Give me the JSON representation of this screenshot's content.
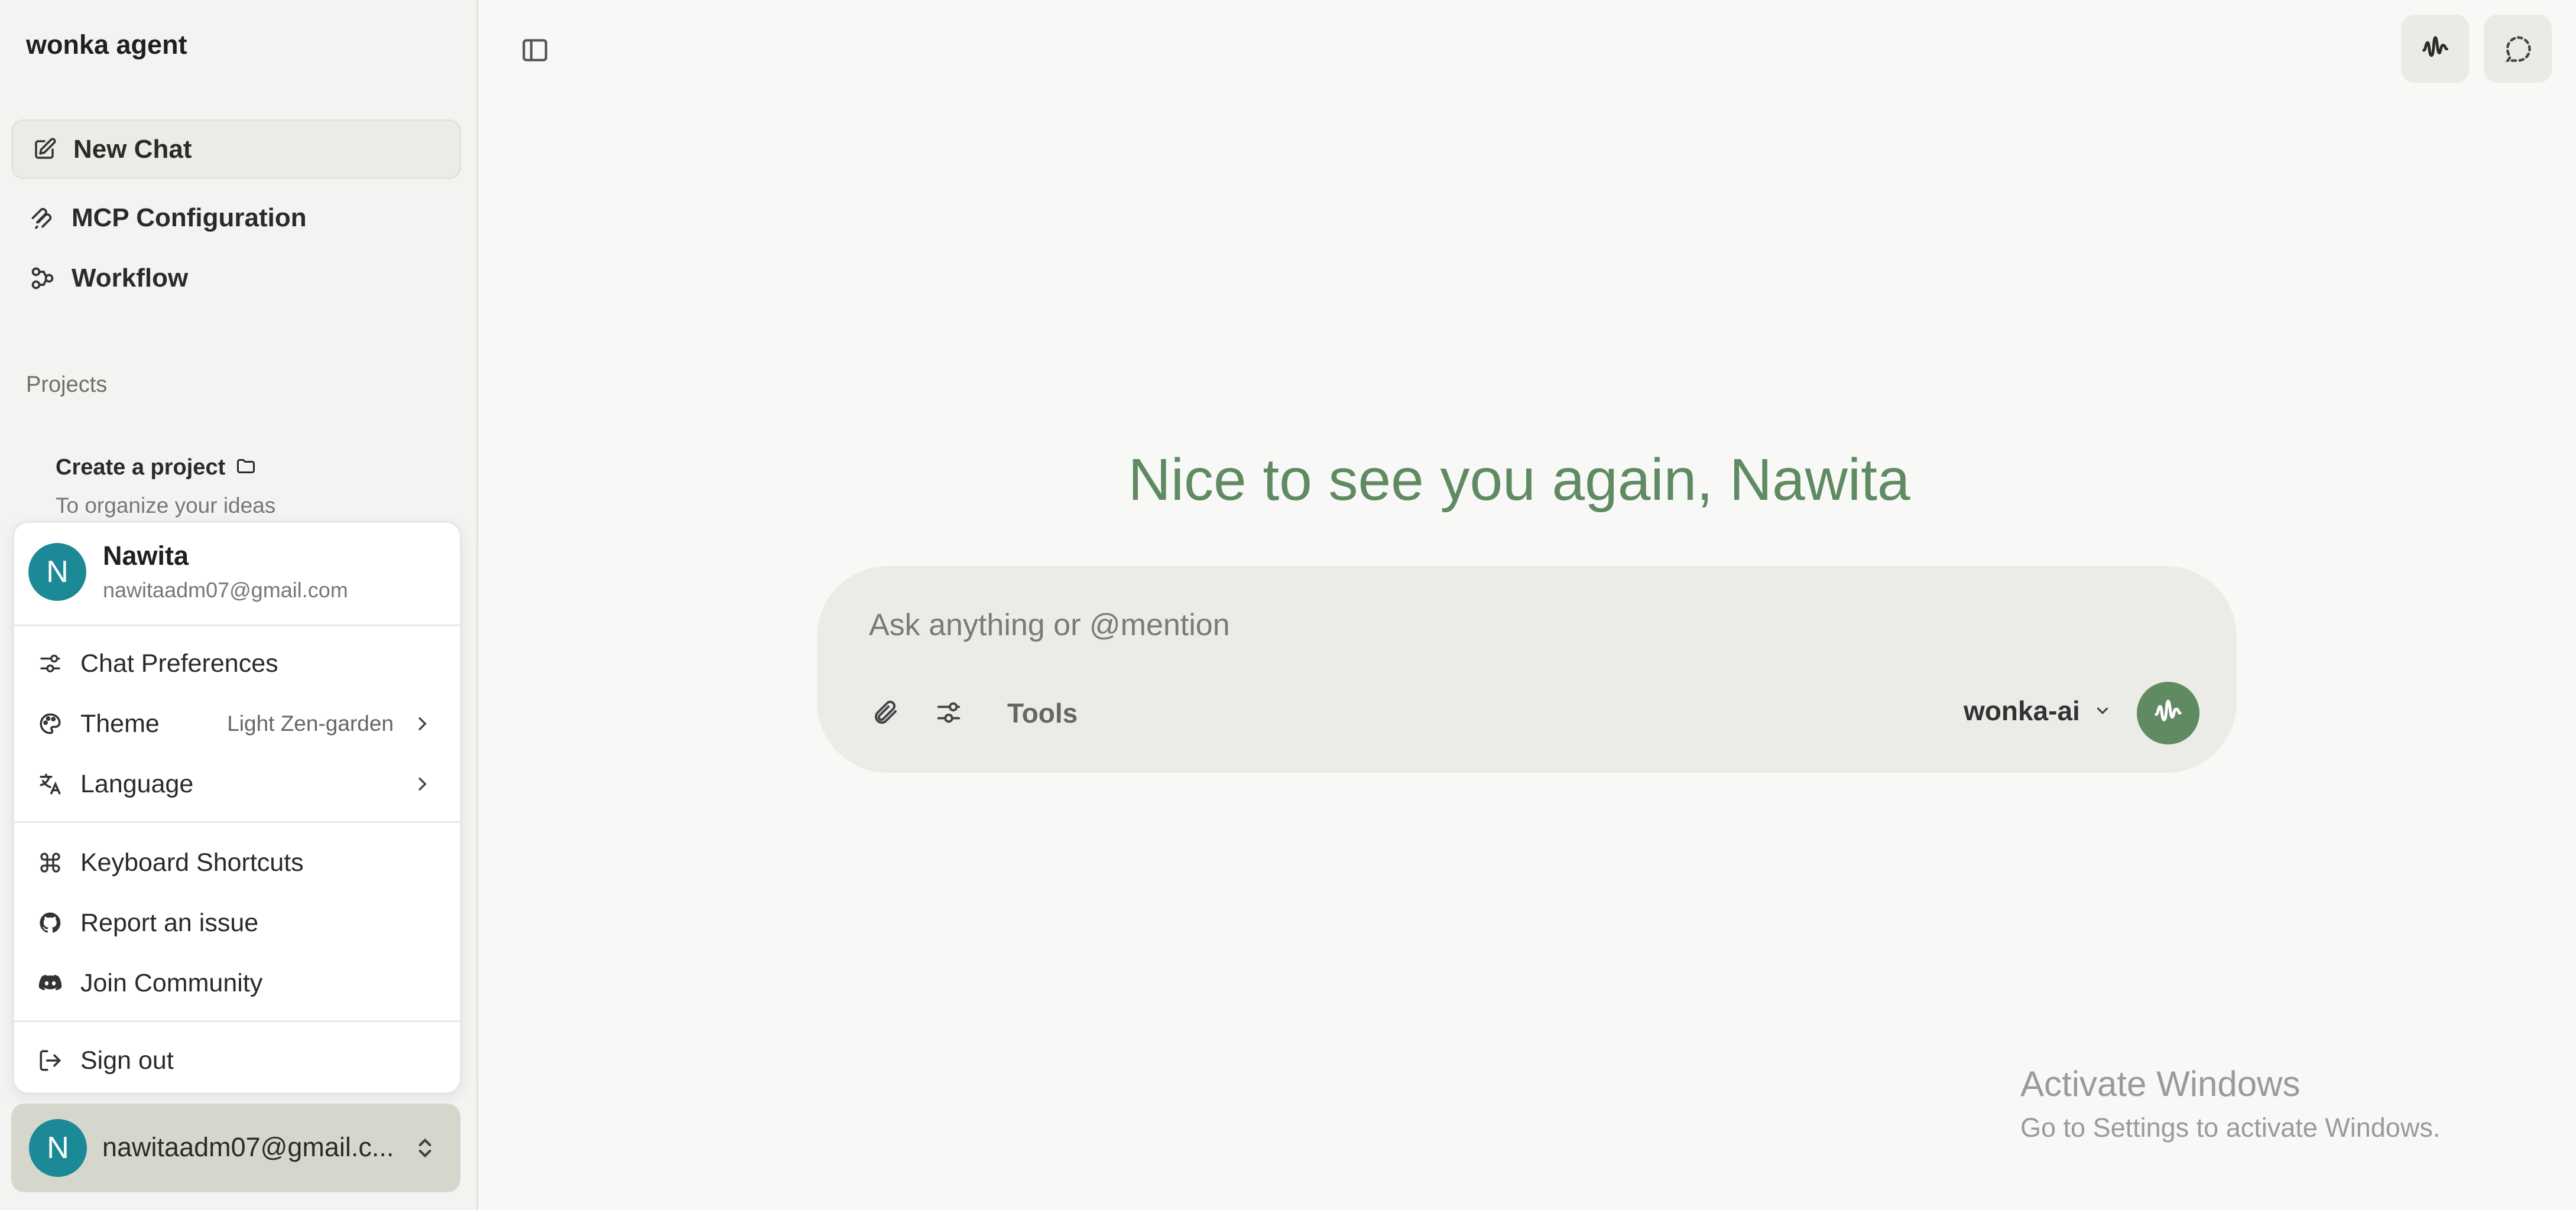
{
  "app": {
    "title": "wonka agent"
  },
  "sidebar": {
    "nav": [
      {
        "label": "New Chat",
        "icon": "pencil-square-icon"
      },
      {
        "label": "MCP Configuration",
        "icon": "mcp-icon"
      },
      {
        "label": "Workflow",
        "icon": "workflow-icon"
      }
    ],
    "projects_label": "Projects",
    "create_project": {
      "title": "Create a project",
      "subtitle": "To organize your ideas"
    }
  },
  "user_menu": {
    "name": "Nawita",
    "email": "nawitaadm07@gmail.com",
    "avatar_initial": "N",
    "items": {
      "chat_preferences": "Chat Preferences",
      "theme": "Theme",
      "theme_value": "Light Zen-garden",
      "language": "Language",
      "keyboard_shortcuts": "Keyboard Shortcuts",
      "report_issue": "Report an issue",
      "join_community": "Join Community",
      "sign_out": "Sign out"
    }
  },
  "account": {
    "avatar_initial": "N",
    "email_truncated": "nawitaadm07@gmail.c..."
  },
  "main": {
    "greeting": "Nice to see you again, Nawita",
    "composer": {
      "placeholder": "Ask anything or @mention",
      "value": "",
      "tools_label": "Tools",
      "model": "wonka-ai"
    }
  },
  "watermark": {
    "title": "Activate Windows",
    "subtitle": "Go to Settings to activate Windows."
  },
  "colors": {
    "accent": "#5f8a62",
    "avatar": "#1b8a96",
    "sidebar_bg": "#f3f3f1",
    "page_bg": "#f8f8f6"
  }
}
